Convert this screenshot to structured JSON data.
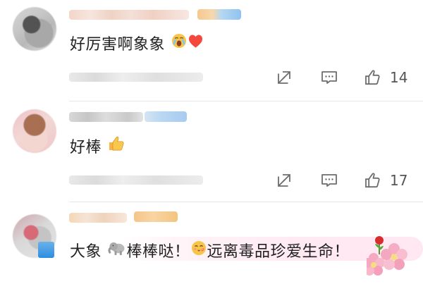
{
  "comments": [
    {
      "text": "好厉害啊象象",
      "emojis": [
        "crying-face-emoji",
        "heart-emoji"
      ],
      "likes": "14"
    },
    {
      "text": "好棒",
      "emojis": [
        "thumbs-up-emoji"
      ],
      "likes": "17"
    },
    {
      "text_part1": "大象",
      "text_part2": "棒棒哒！",
      "text_part3": "远离毒品珍爱生命！",
      "emojis": [
        "elephant-emoji",
        "kissing-face-emoji",
        "rose-emoji",
        "cherry-blossom-emoji"
      ]
    }
  ],
  "icons": {
    "share": "share-icon",
    "comment": "comment-icon",
    "like": "thumbs-up-icon"
  },
  "colors": {
    "text": "#222222",
    "icon": "#6d6d6d",
    "count": "#555555",
    "divider": "#e7e7e7"
  }
}
